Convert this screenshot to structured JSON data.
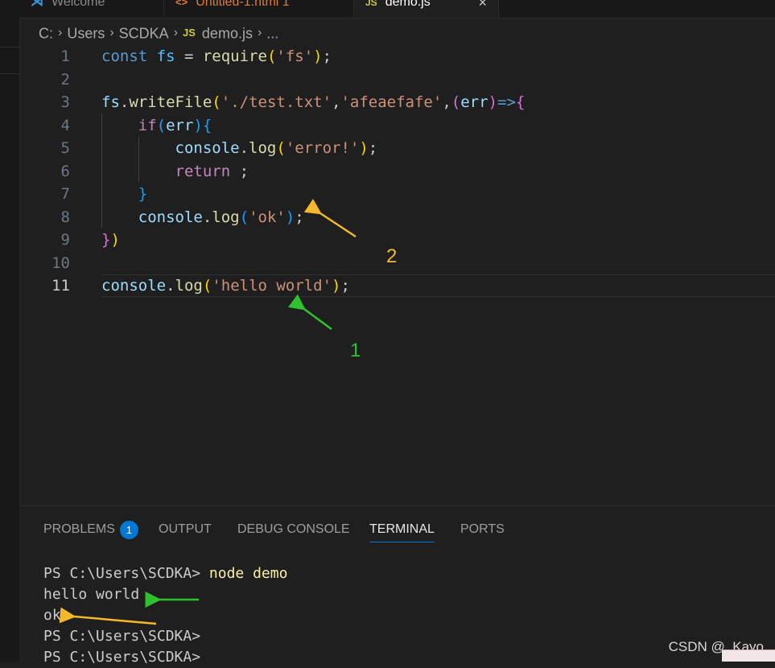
{
  "tabs": [
    {
      "label": "Welcome",
      "icon": "vscode-logo-icon"
    },
    {
      "label": "Untitled-1.html 1",
      "icon": "html-file-icon"
    },
    {
      "label": "demo.js",
      "icon": "js-file-icon",
      "active": true,
      "close": "×"
    }
  ],
  "breadcrumb": {
    "drive": "C:",
    "users": "Users",
    "user": "SCDKA",
    "file_icon": "JS",
    "file": "demo.js",
    "more": "..."
  },
  "editor": {
    "line_numbers": [
      "1",
      "2",
      "3",
      "4",
      "5",
      "6",
      "7",
      "8",
      "9",
      "10",
      "11"
    ],
    "active_line": "11",
    "lines": [
      [
        [
          "kw",
          "const "
        ],
        [
          "cst",
          "fs"
        ],
        [
          "p",
          " = "
        ],
        [
          "fn",
          "require"
        ],
        [
          "b1",
          "("
        ],
        [
          "str",
          "'fs'"
        ],
        [
          "b1",
          ")"
        ],
        [
          "p",
          ";"
        ]
      ],
      [],
      [
        [
          "var",
          "fs"
        ],
        [
          "p",
          "."
        ],
        [
          "fn",
          "writeFile"
        ],
        [
          "b1",
          "("
        ],
        [
          "str",
          "'./test.txt'"
        ],
        [
          "p",
          ","
        ],
        [
          "str",
          "'afeaefafe'"
        ],
        [
          "p",
          ","
        ],
        [
          "b2",
          "("
        ],
        [
          "var",
          "err"
        ],
        [
          "b2",
          ")"
        ],
        [
          "kw",
          "=>"
        ],
        [
          "b2",
          "{"
        ]
      ],
      [
        [
          "p",
          "    "
        ],
        [
          "ctl",
          "if"
        ],
        [
          "b3",
          "("
        ],
        [
          "var",
          "err"
        ],
        [
          "b3",
          ")"
        ],
        [
          "b3",
          "{"
        ]
      ],
      [
        [
          "p",
          "        "
        ],
        [
          "var",
          "console"
        ],
        [
          "p",
          "."
        ],
        [
          "fn",
          "log"
        ],
        [
          "b1",
          "("
        ],
        [
          "str",
          "'error!'"
        ],
        [
          "b1",
          ")"
        ],
        [
          "p",
          ";"
        ]
      ],
      [
        [
          "p",
          "        "
        ],
        [
          "ctl",
          "return"
        ],
        [
          "p",
          " ;"
        ]
      ],
      [
        [
          "p",
          "    "
        ],
        [
          "b3",
          "}"
        ]
      ],
      [
        [
          "p",
          "    "
        ],
        [
          "var",
          "console"
        ],
        [
          "p",
          "."
        ],
        [
          "fn",
          "log"
        ],
        [
          "b3",
          "("
        ],
        [
          "str",
          "'ok'"
        ],
        [
          "b3",
          ")"
        ],
        [
          "p",
          ";"
        ]
      ],
      [
        [
          "b2",
          "}"
        ],
        [
          "b1",
          ")"
        ]
      ],
      [],
      [
        [
          "var",
          "console"
        ],
        [
          "p",
          "."
        ],
        [
          "fn",
          "log"
        ],
        [
          "b1",
          "("
        ],
        [
          "str",
          "'hello world'"
        ],
        [
          "b1",
          ")"
        ],
        [
          "p",
          ";"
        ]
      ]
    ]
  },
  "annotations": {
    "label_1": "1",
    "label_2": "2",
    "green": "#2ec22e",
    "orange": "#f5b82a"
  },
  "panel": {
    "tabs": [
      "PROBLEMS",
      "OUTPUT",
      "DEBUG CONSOLE",
      "TERMINAL",
      "PORTS"
    ],
    "active_tab": "TERMINAL",
    "problems_count": "1",
    "terminal": {
      "prompt": "PS C:\\Users\\SCDKA> ",
      "command": "node demo",
      "output_1": "hello world",
      "output_2": "ok",
      "prompt_2": "PS C:\\Users\\SCDKA>",
      "prompt_3": "PS C:\\Users\\SCDKA>"
    }
  },
  "watermark": "CSDN @_Kayo",
  "colors": {
    "accent": "#0078d4",
    "background": "#1f1f1f"
  }
}
